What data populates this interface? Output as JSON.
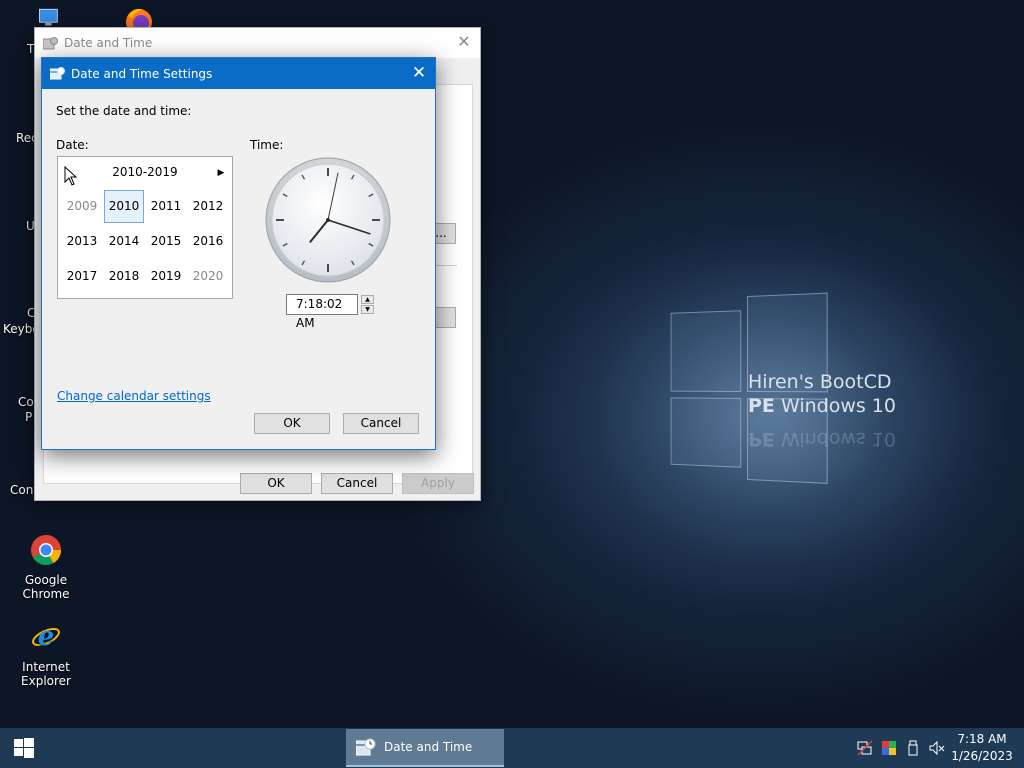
{
  "desktop": {
    "brand_line1": "Hiren's BootCD",
    "brand_line2_bold": "PE",
    "brand_line2_rest": " Windows 10",
    "icons": [
      {
        "label": "Google Chrome",
        "icon": "chrome-icon"
      },
      {
        "label": "Internet Explorer",
        "icon": "internet-explorer-icon"
      }
    ],
    "partial_labels": [
      "Th",
      "Rec",
      "U",
      "C",
      "Keybo",
      "Co",
      "P",
      "Cont"
    ]
  },
  "back_window": {
    "title": "Date and Time",
    "partial_button": "...",
    "ok_label": "OK",
    "cancel_label": "Cancel",
    "apply_label": "Apply"
  },
  "dialog": {
    "title": "Date and Time Settings",
    "instruction": "Set the date and time:",
    "date_label": "Date:",
    "time_label": "Time:",
    "calendar": {
      "header": "2010-2019",
      "years": [
        {
          "label": "2009",
          "state": "dim"
        },
        {
          "label": "2010",
          "state": "selected"
        },
        {
          "label": "2011",
          "state": "normal"
        },
        {
          "label": "2012",
          "state": "normal"
        },
        {
          "label": "2013",
          "state": "normal"
        },
        {
          "label": "2014",
          "state": "normal"
        },
        {
          "label": "2015",
          "state": "normal"
        },
        {
          "label": "2016",
          "state": "normal"
        },
        {
          "label": "2017",
          "state": "normal"
        },
        {
          "label": "2018",
          "state": "normal"
        },
        {
          "label": "2019",
          "state": "normal"
        },
        {
          "label": "2020",
          "state": "dim"
        }
      ]
    },
    "clock": {
      "hour": 7,
      "minute": 18,
      "second": 2
    },
    "time_value": "7:18:02 AM",
    "change_calendar_link": "Change calendar settings",
    "ok_label": "OK",
    "cancel_label": "Cancel"
  },
  "taskbar": {
    "task_label": "Date and Time",
    "time": "7:18 AM",
    "date": "1/26/2023"
  },
  "colors": {
    "accent": "#0a6cc6",
    "taskbar": "#1f3a55",
    "link": "#0066cc"
  }
}
